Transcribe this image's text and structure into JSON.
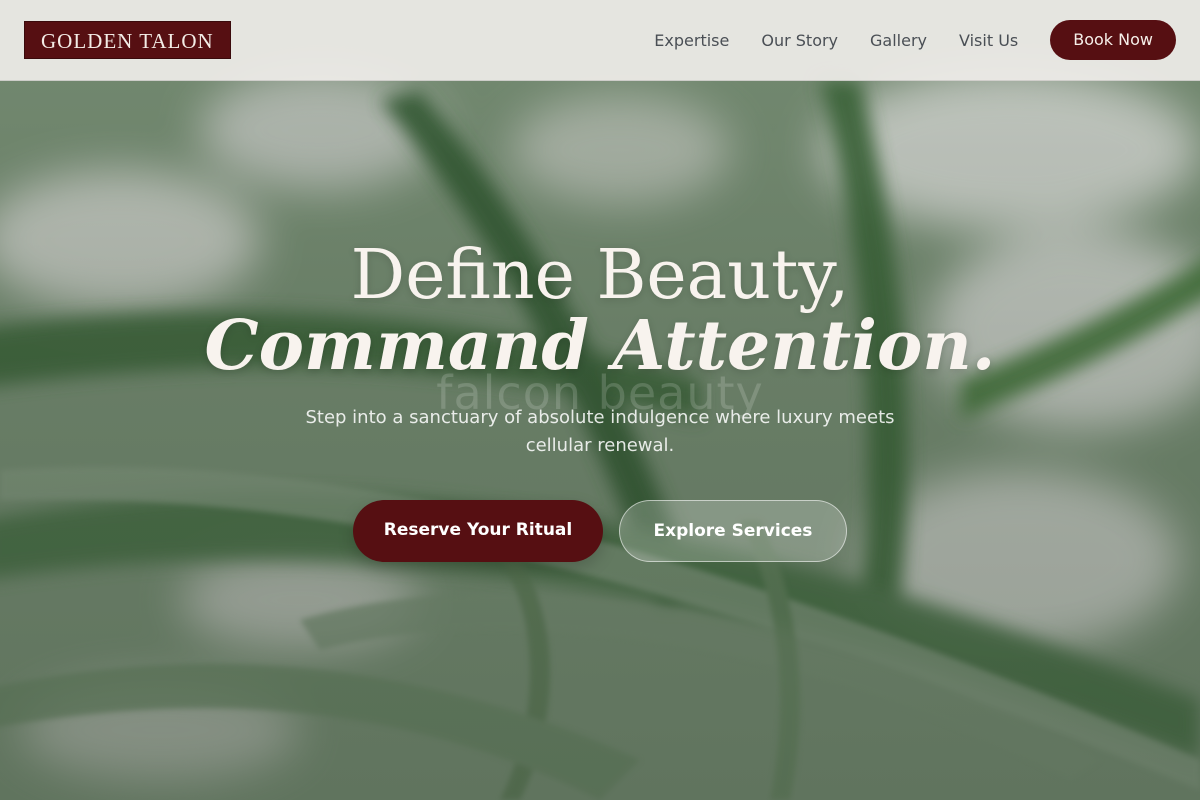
{
  "brand": {
    "logo_text": "GOLDEN TALON"
  },
  "nav": {
    "links": [
      {
        "label": "Expertise"
      },
      {
        "label": "Our Story"
      },
      {
        "label": "Gallery"
      },
      {
        "label": "Visit Us"
      }
    ],
    "cta_label": "Book Now"
  },
  "hero": {
    "headline_line1": "Define Beauty,",
    "headline_line2": "Command Attention.",
    "watermark": "falcon beauty",
    "subtitle": "Step into a sanctuary of absolute indulgence where luxury meets cellular renewal.",
    "primary_button": "Reserve Your Ritual",
    "secondary_button": "Explore Services"
  },
  "colors": {
    "brand_maroon": "#560f12",
    "navbar_bg": "#eeece8",
    "hero_text": "#f8f3ee",
    "foliage_green": "#5f7f5c"
  },
  "background": {
    "image_subject": "blurred palm leaves"
  }
}
